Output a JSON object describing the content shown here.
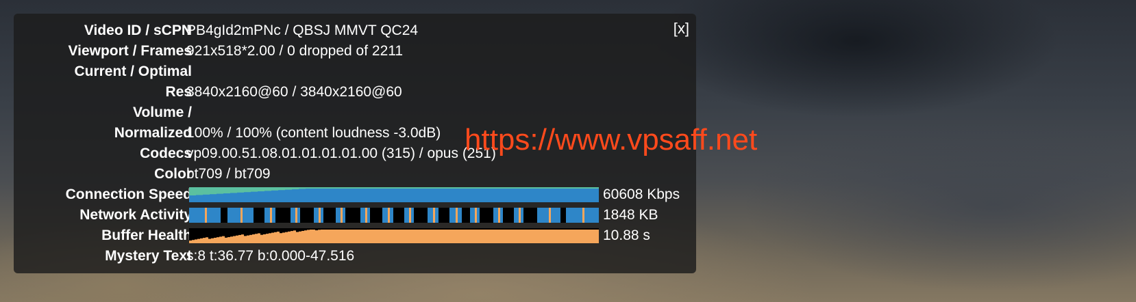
{
  "stats_panel": {
    "close_label": "[x]",
    "rows": [
      {
        "label": "Video ID / sCPN",
        "value": "PB4gId2mPNc / QBSJ MMVT QC24"
      },
      {
        "label": "Viewport / Frames",
        "value": "921x518*2.00 / 0 dropped of 2211"
      },
      {
        "label": "Current / Optimal",
        "value": ""
      },
      {
        "label": "Res",
        "value": "3840x2160@60 / 3840x2160@60"
      },
      {
        "label": "Volume /",
        "value": ""
      },
      {
        "label": "Normalized",
        "value": "100% / 100% (content loudness -3.0dB)"
      },
      {
        "label": "Codecs",
        "value": "vp09.00.51.08.01.01.01.01.00 (315) / opus (251)"
      },
      {
        "label": "Color",
        "value": "bt709 / bt709"
      }
    ],
    "graphs": [
      {
        "label": "Connection Speed",
        "value": "60608 Kbps",
        "colors": {
          "primary": "#2e86c8",
          "secondary": "#5bc0a0"
        }
      },
      {
        "label": "Network Activity",
        "value": "1848 KB",
        "colors": {
          "primary": "#2e86c8",
          "secondary": "#f5a65b"
        }
      },
      {
        "label": "Buffer Health",
        "value": "10.88 s",
        "colors": {
          "primary": "#f5a65b"
        }
      }
    ],
    "mystery": {
      "label": "Mystery Text",
      "value": "s:8 t:36.77 b:0.000-47.516"
    }
  },
  "watermark": "https://www.vpsaff.net"
}
